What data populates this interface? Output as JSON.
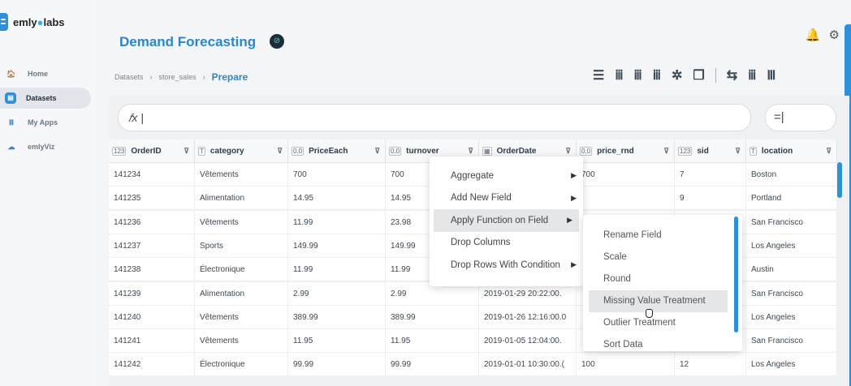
{
  "brand": {
    "name_part1": "emly",
    "dot": "●",
    "name_part2": "labs"
  },
  "nav": [
    {
      "label": "Home",
      "icon": "🏠"
    },
    {
      "label": "Datasets",
      "icon": "▤"
    },
    {
      "label": "My Apps",
      "icon": "Ⅲ"
    },
    {
      "label": "emlyViz",
      "icon": "☁"
    }
  ],
  "header": {
    "title": "Demand Forecasting",
    "badge": "⊘",
    "bell": "🔔",
    "gear": "⚙"
  },
  "breadcrumb": {
    "items": [
      "Datasets",
      "store_sales"
    ],
    "sep": "›",
    "current": "Prepare"
  },
  "toolbar": [
    "☰",
    "ⅲ",
    "ⅲ",
    "ⅲ",
    "✲",
    "❐",
    "⇆",
    "ⅲ",
    "Ⅲ"
  ],
  "formula": {
    "prefix": "𝑓x |",
    "button": "=|"
  },
  "columns": [
    {
      "type": "123",
      "name": "OrderID",
      "filter": "⊽"
    },
    {
      "type": "T",
      "name": "category",
      "filter": "⊽"
    },
    {
      "type": "0,0",
      "name": "PriceEach",
      "filter": "⊽"
    },
    {
      "type": "0,0",
      "name": "turnover",
      "filter": "⊽"
    },
    {
      "type": "▦",
      "name": "OrderDate",
      "filter": "⊽"
    },
    {
      "type": "0,0",
      "name": "price_rnd",
      "filter": "⊽"
    },
    {
      "type": "123",
      "name": "sid",
      "filter": "⊽"
    },
    {
      "type": "T",
      "name": "location",
      "filter": "⊽"
    }
  ],
  "rows": [
    [
      "141234",
      "Vêtements",
      "700",
      "700",
      "",
      "700",
      "7",
      "Boston"
    ],
    [
      "141235",
      "Alimentation",
      "14.95",
      "14.95",
      "",
      "",
      "9",
      "Portland"
    ],
    [
      "141236",
      "Vêtements",
      "11.99",
      "23.98",
      "",
      "",
      "",
      "San Francisco"
    ],
    [
      "141237",
      "Sports",
      "149.99",
      "149.99",
      "",
      "",
      "",
      "Los Angeles"
    ],
    [
      "141238",
      "Électronique",
      "11.99",
      "11.99",
      "",
      "",
      "",
      "Austin"
    ],
    [
      "141239",
      "Alimentation",
      "2.99",
      "2.99",
      "2019-01-29 20:22:00.",
      "",
      "",
      "San Francisco"
    ],
    [
      "141240",
      "Vêtements",
      "389.99",
      "389.99",
      "2019-01-26 12:16:00.0",
      "",
      "",
      "Los Angeles"
    ],
    [
      "141241",
      "Vêtements",
      "11.95",
      "11.95",
      "2019-01-05 12:04:00.",
      "",
      "",
      "San Francisco"
    ],
    [
      "141242",
      "Électronique",
      "99.99",
      "99.99",
      "2019-01-01 10:30:00.(",
      "100",
      "12",
      "Los Angeles"
    ]
  ],
  "context_menu": {
    "items": [
      {
        "label": "Aggregate",
        "arrow": "▶"
      },
      {
        "label": "Add New Field",
        "arrow": "▶"
      },
      {
        "label": "Apply Function on Field",
        "arrow": "▶"
      },
      {
        "label": "Drop Columns",
        "arrow": ""
      },
      {
        "label": "Drop Rows With Condition",
        "arrow": "▶"
      }
    ],
    "highlighted": "Apply Function on Field"
  },
  "submenu": {
    "items": [
      "Rename Field",
      "Scale",
      "Round",
      "Missing Value Treatment",
      "Outlier Treatment",
      "Sort Data"
    ],
    "highlighted": "Missing Value Treatment"
  },
  "colors": {
    "accent": "#2f8fd8",
    "title": "#2d86c9"
  }
}
